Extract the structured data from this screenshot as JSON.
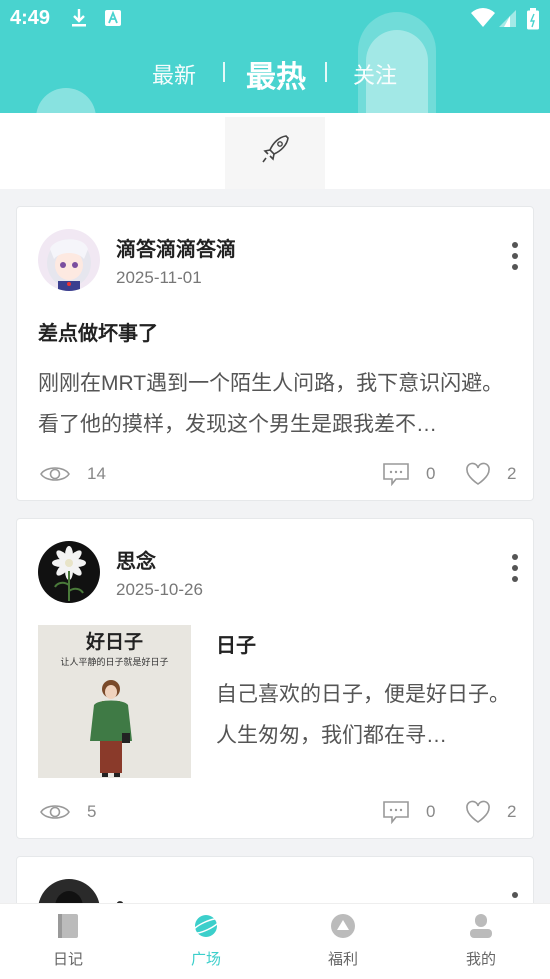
{
  "status_bar": {
    "time": "4:49"
  },
  "top_tabs": [
    {
      "label": "最新",
      "active": false
    },
    {
      "label": "最热",
      "active": true
    },
    {
      "label": "关注",
      "active": false
    }
  ],
  "posts": [
    {
      "username": "滴答滴滴答滴",
      "date": "2025-11-01",
      "title": "差点做坏事了",
      "body": "刚刚在MRT遇到一个陌生人问路，我下意识闪避。看了他的摸样，发现这个男生是跟我差不…",
      "views": "14",
      "comments": "0",
      "likes": "2"
    },
    {
      "username": "思念",
      "date": "2025-10-26",
      "title": "日子",
      "body": "自己喜欢的日子，便是好日子。人生匆匆，我们都在寻…",
      "thumb_title": "好日子",
      "thumb_subtitle": "让人平静的日子就是好日子",
      "views": "5",
      "comments": "0",
      "likes": "2"
    },
    {
      "username": "。"
    }
  ],
  "bottom_nav": [
    {
      "label": "日记",
      "icon": "diary-icon",
      "active": false
    },
    {
      "label": "广场",
      "icon": "planet-icon",
      "active": true
    },
    {
      "label": "福利",
      "icon": "welfare-icon",
      "active": false
    },
    {
      "label": "我的",
      "icon": "profile-icon",
      "active": false
    }
  ],
  "colors": {
    "accent": "#49d3cf",
    "nav_active": "#3ccfcb"
  }
}
